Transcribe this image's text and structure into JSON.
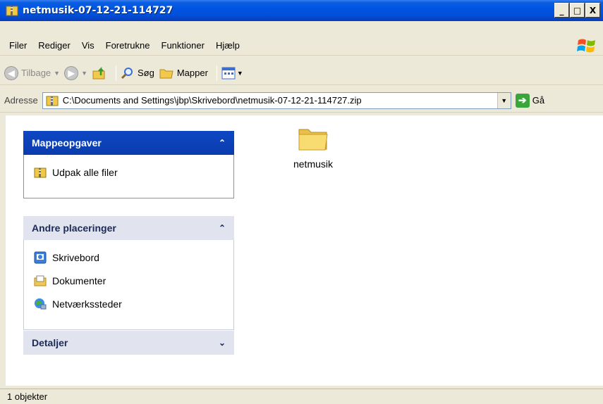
{
  "window": {
    "title": "netmusik-07-12-21-114727"
  },
  "title_buttons": {
    "minimize": "_",
    "maximize": "□",
    "close": "X"
  },
  "menu": [
    "Filer",
    "Rediger",
    "Vis",
    "Foretrukne",
    "Funktioner",
    "Hjælp"
  ],
  "toolbar": {
    "back_label": "Tilbage",
    "search_label": "Søg",
    "folders_label": "Mapper"
  },
  "address": {
    "label": "Adresse",
    "path": "C:\\Documents and Settings\\jbp\\Skrivebord\\netmusik-07-12-21-114727.zip",
    "go_label": "Gå"
  },
  "tasks": {
    "folder_tasks": {
      "title": "Mappeopgaver",
      "items": [
        "Udpak alle filer"
      ]
    },
    "other_places": {
      "title": "Andre placeringer",
      "items": [
        "Skrivebord",
        "Dokumenter",
        "Netværkssteder"
      ]
    },
    "details": {
      "title": "Detaljer"
    }
  },
  "files": [
    {
      "name": "netmusik",
      "icon": "folder-icon"
    }
  ],
  "status": {
    "text": "1 objekter"
  },
  "colors": {
    "titlebar": "#0054e3",
    "task_header_dark": "#0a3cad",
    "task_header_light": "#e1e4ee",
    "window_bg": "#ece9d8"
  }
}
